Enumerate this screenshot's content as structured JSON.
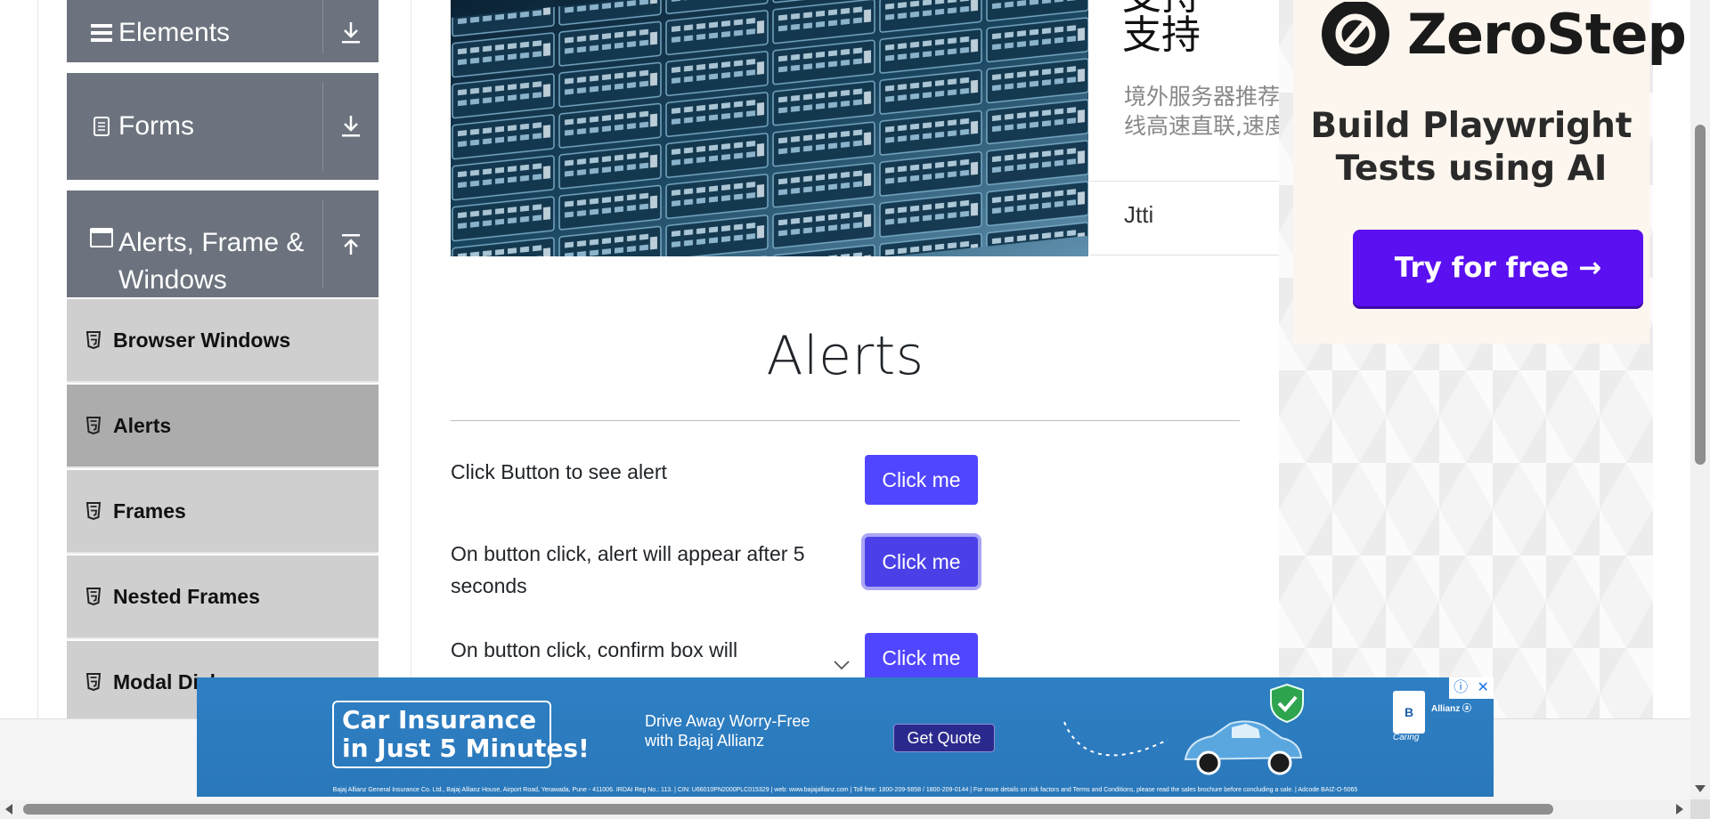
{
  "sidebar": {
    "groups": [
      {
        "label": "Elements",
        "icon": "hamburger-icon",
        "toggle_icon": "download-arrow-icon"
      },
      {
        "label": "Forms",
        "icon": "document-icon",
        "toggle_icon": "download-arrow-icon"
      },
      {
        "label_line1": "Alerts, Frame &",
        "label_line2": "Windows",
        "icon": "window-icon",
        "toggle_icon": "upload-arrow-icon"
      }
    ],
    "items": [
      {
        "label": "Browser Windows",
        "active": false
      },
      {
        "label": "Alerts",
        "active": true
      },
      {
        "label": "Frames",
        "active": false
      },
      {
        "label": "Nested Frames",
        "active": false
      },
      {
        "label": "Modal Dial",
        "active": false
      }
    ]
  },
  "ad_card": {
    "title_line1": "支持",
    "desc_line1": "境外服务器推荐",
    "desc_line2": "线高速直联,速度",
    "brand": "Jtti"
  },
  "main": {
    "title": "Alerts",
    "rows": [
      {
        "label": "Click Button to see alert",
        "button": "Click me"
      },
      {
        "label": "On button click, alert will appear after 5 seconds",
        "button": "Click me"
      },
      {
        "label": "On button click, confirm box will",
        "button": "Click me"
      }
    ]
  },
  "right_ad": {
    "brand": "ZeroStep",
    "headline_line1": "Build Playwright",
    "headline_line2": "Tests using AI",
    "cta": "Try for free →",
    "cta_color": "#5a10f0"
  },
  "banner_ad": {
    "headline_line1": "Car Insurance",
    "headline_line2": "in Just 5 Minutes!",
    "tagline_line1": "Drive Away Worry-Free",
    "tagline_line2": "with Bajaj Allianz",
    "cta": "Get Quote",
    "logo_text": "B",
    "logo_name": "Allianz ⓐ",
    "logo_tag": "Caring",
    "fine_print": "Bajaj Allianz General Insurance Co. Ltd., Bajaj Allianz House, Airport Road, Yerawada, Pune - 411006. IRDAI Reg No.: 113. | CIN: U66010PN2000PLC015329 | web: www.bajajallianz.com | Toll free: 1800-209-5858 / 1800-209-0144 | For more details on risk factors and Terms and Conditions, please read the sales brochure before concluding a sale. | Adcode BAIZ-O-5065",
    "info_icon": "ⓘ",
    "close_icon": "✕"
  },
  "colors": {
    "sidebar_header": "#6c737e",
    "sidebar_item": "#cfcfcf",
    "sidebar_item_active": "#acacac",
    "primary_button": "#5146ff",
    "banner_bg": "#2e7fc4"
  }
}
